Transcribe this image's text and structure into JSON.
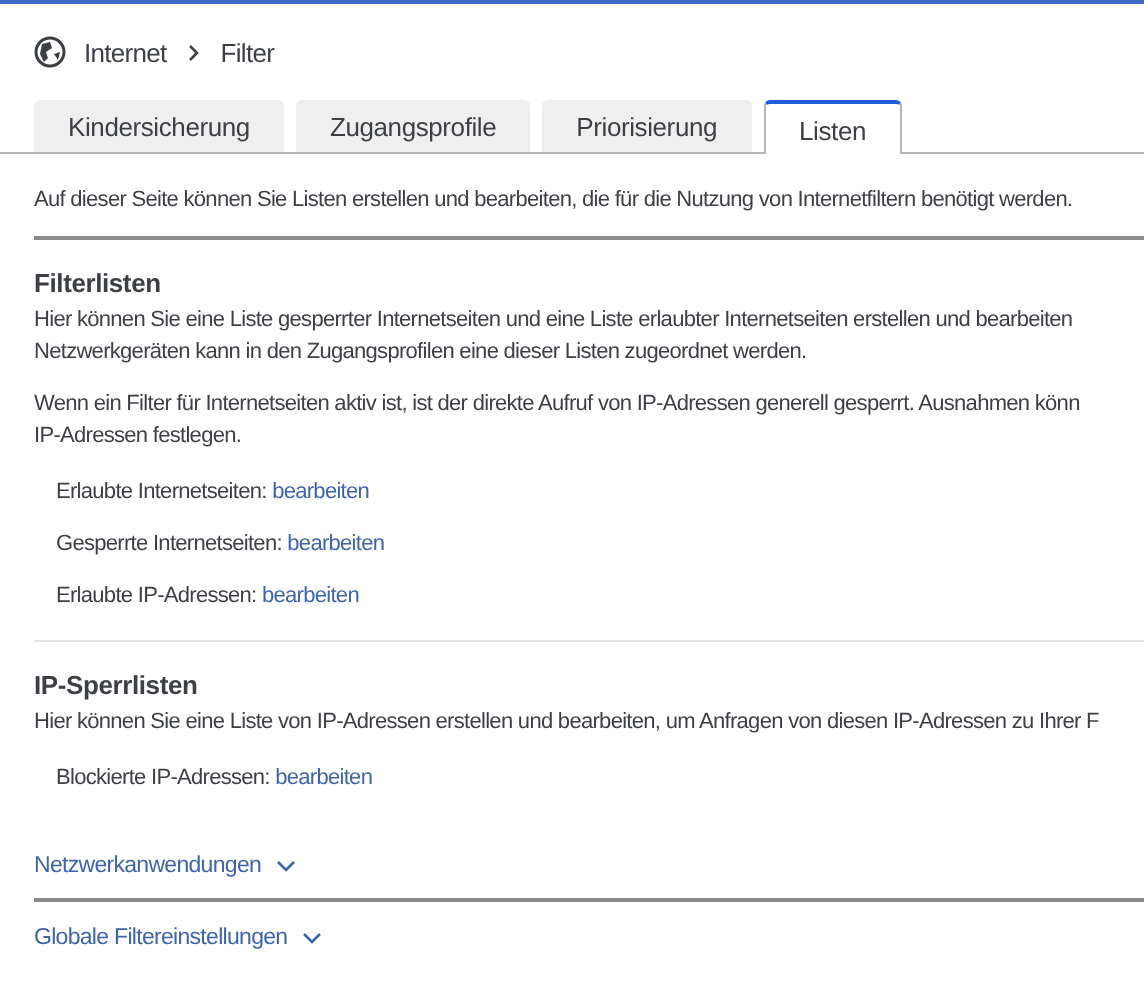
{
  "breadcrumb": [
    "Internet",
    "Filter"
  ],
  "tabs": [
    {
      "label": "Kindersicherung",
      "selected": false
    },
    {
      "label": "Zugangsprofile",
      "selected": false
    },
    {
      "label": "Priorisierung",
      "selected": false
    },
    {
      "label": "Listen",
      "selected": true
    }
  ],
  "intro": "Auf dieser Seite können Sie Listen erstellen und bearbeiten, die für die Nutzung von Internetfiltern benötigt werden.",
  "sections": [
    {
      "title": "Filterlisten",
      "paragraphs": [
        [
          "Hier können Sie eine Liste gesperrter Internetseiten und eine Liste erlaubter Internetseiten erstellen und bearbeiten",
          "Netzwerkgeräten kann in den Zugangsprofilen eine dieser Listen zugeordnet werden."
        ],
        [
          "Wenn ein Filter für Internetseiten aktiv ist, ist der direkte Aufruf von IP-Adressen generell gesperrt. Ausnahmen könn",
          "IP-Adressen festlegen."
        ]
      ],
      "items": [
        {
          "label": "Erlaubte Internetseiten:",
          "link": "bearbeiten"
        },
        {
          "label": "Gesperrte Internetseiten:",
          "link": "bearbeiten"
        },
        {
          "label": "Erlaubte IP-Adressen:",
          "link": "bearbeiten"
        }
      ]
    },
    {
      "title": "IP-Sperrlisten",
      "paragraphs": [
        [
          "Hier können Sie eine Liste von IP-Adressen erstellen und bearbeiten, um Anfragen von diesen IP-Adressen zu Ihrer F"
        ]
      ],
      "items": [
        {
          "label": "Blockierte IP-Adressen:",
          "link": "bearbeiten"
        }
      ]
    }
  ],
  "expanders": [
    {
      "label": "Netzwerkanwendungen",
      "expanded": false
    },
    {
      "label": "Globale Filtereinstellungen",
      "expanded": false
    }
  ]
}
